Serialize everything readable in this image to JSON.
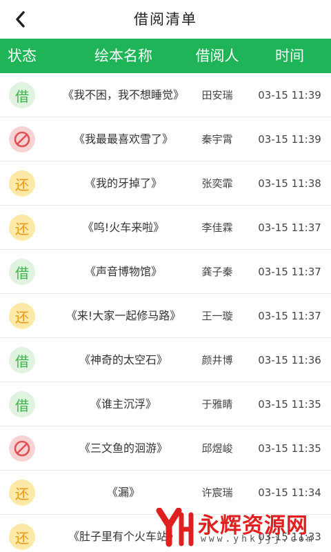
{
  "header": {
    "title": "借阅清单"
  },
  "columns": {
    "status": "状态",
    "book": "绘本名称",
    "borrower": "借阅人",
    "time": "时间"
  },
  "status_labels": {
    "borrow": "借",
    "return": "还"
  },
  "rows": [
    {
      "status": "borrow",
      "book": "《我不困，我不想睡觉》",
      "borrower": "田安瑞",
      "time": "03-15 11:39"
    },
    {
      "status": "banned",
      "book": "《我最最喜欢雪了》",
      "borrower": "秦宇霄",
      "time": "03-15 11:39"
    },
    {
      "status": "return",
      "book": "《我的牙掉了》",
      "borrower": "张奕霏",
      "time": "03-15 11:38"
    },
    {
      "status": "return",
      "book": "《呜!火车来啦》",
      "borrower": "李佳霖",
      "time": "03-15 11:37"
    },
    {
      "status": "borrow",
      "book": "《声音博物馆》",
      "borrower": "龚子秦",
      "time": "03-15 11:37"
    },
    {
      "status": "return",
      "book": "《来!大家一起修马路》",
      "borrower": "王一璇",
      "time": "03-15 11:37"
    },
    {
      "status": "borrow",
      "book": "《神奇的太空石》",
      "borrower": "颜井博",
      "time": "03-15 11:36"
    },
    {
      "status": "borrow",
      "book": "《谁主沉浮》",
      "borrower": "于雅睛",
      "time": "03-15 11:35"
    },
    {
      "status": "banned",
      "book": "《三文鱼的洄游》",
      "borrower": "邱煜峻",
      "time": "03-15 11:35"
    },
    {
      "status": "return",
      "book": "《漏》",
      "borrower": "许宸瑞",
      "time": "03-15 11:34"
    },
    {
      "status": "return",
      "book": "《肚子里有个火车站》",
      "borrower": "",
      "time": "03-15 11:33"
    }
  ],
  "watermark": {
    "name": "永辉资源网",
    "url": "www.yhkjjj.com"
  },
  "colors": {
    "accent": "#1fb457",
    "borrow": "#3fb24a",
    "return": "#e69a13",
    "banned": "#e05050",
    "watermark": "#e02020"
  }
}
